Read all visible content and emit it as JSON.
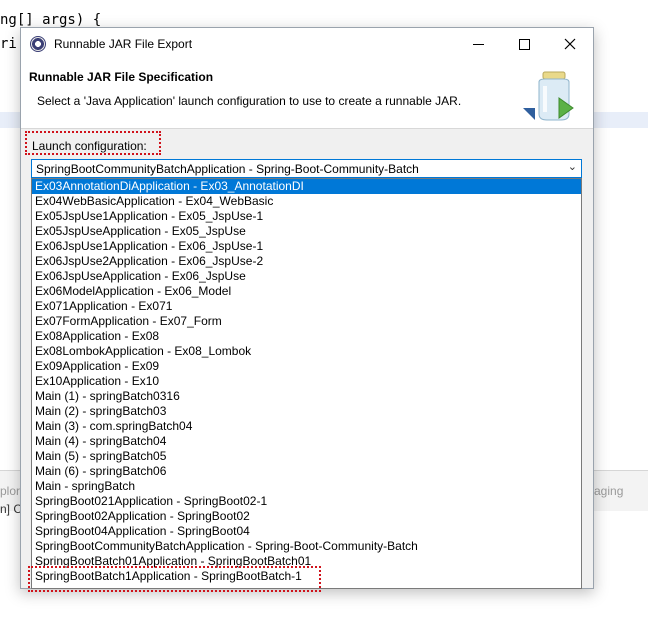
{
  "background": {
    "code_line_1": "ng[] args) {",
    "code_line_2": "ri",
    "panel_left_1": "plor",
    "panel_right_1": "aging",
    "panel_left_2": "n] C"
  },
  "dialog": {
    "title": "Runnable JAR File Export",
    "header_title": "Runnable JAR File Specification",
    "header_description": "Select a 'Java Application' launch configuration to use to create a runnable JAR.",
    "launch_label": "Launch configuration:",
    "selected_configuration": "SpringBootCommunityBatchApplication - Spring-Boot-Community-Batch",
    "options": [
      "Ex03AnnotationDiApplication - Ex03_AnnotationDI",
      "Ex04WebBasicApplication - Ex04_WebBasic",
      "Ex05JspUse1Application - Ex05_JspUse-1",
      "Ex05JspUseApplication - Ex05_JspUse",
      "Ex06JspUse1Application - Ex06_JspUse-1",
      "Ex06JspUse2Application - Ex06_JspUse-2",
      "Ex06JspUseApplication - Ex06_JspUse",
      "Ex06ModelApplication - Ex06_Model",
      "Ex071Application - Ex071",
      "Ex07FormApplication - Ex07_Form",
      "Ex08Application - Ex08",
      "Ex08LombokApplication - Ex08_Lombok",
      "Ex09Application - Ex09",
      "Ex10Application - Ex10",
      "Main (1) - springBatch0316",
      "Main (2) - springBatch03",
      "Main (3) - com.springBatch04",
      "Main (4) - springBatch04",
      "Main (5) - springBatch05",
      "Main (6) - springBatch06",
      "Main - springBatch",
      "SpringBoot021Application - SpringBoot02-1",
      "SpringBoot02Application - SpringBoot02",
      "SpringBoot04Application - SpringBoot04",
      "SpringBootCommunityBatchApplication - Spring-Boot-Community-Batch",
      "SpringBootBatch01Application - SpringBootBatch01",
      "SpringBootBatch1Application - SpringBootBatch-1"
    ]
  },
  "colors": {
    "selection": "#0078d7",
    "highlight_annotation": "#d0121b"
  }
}
